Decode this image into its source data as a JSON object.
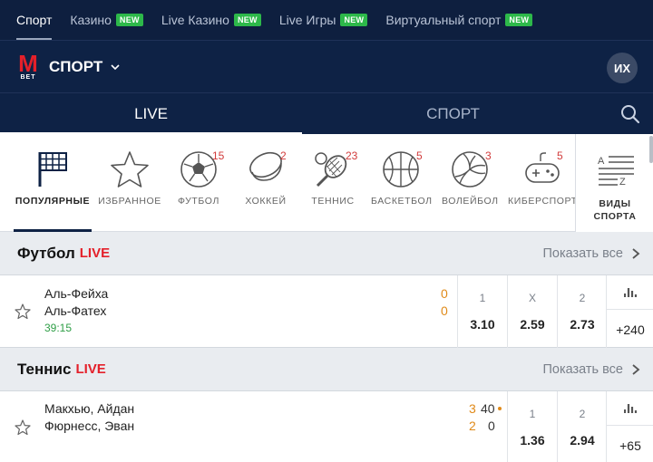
{
  "top_nav": [
    {
      "label": "Спорт",
      "badge": ""
    },
    {
      "label": "Казино",
      "badge": "NEW"
    },
    {
      "label": "Live Казино",
      "badge": "NEW"
    },
    {
      "label": "Live Игры",
      "badge": "NEW"
    },
    {
      "label": "Виртуальный спорт",
      "badge": "NEW"
    }
  ],
  "brand": {
    "logo_letter": "M",
    "logo_sub": "BET",
    "title": "СПОРТ",
    "avatar": "ИХ"
  },
  "tabs": [
    {
      "label": "LIVE"
    },
    {
      "label": "СПОРТ"
    }
  ],
  "sports": [
    {
      "label": "ПОПУЛЯРНЫЕ",
      "count": "",
      "icon": "flag-icon"
    },
    {
      "label": "ИЗБРАННОЕ",
      "count": "",
      "icon": "star-icon"
    },
    {
      "label": "ФУТБОЛ",
      "count": "15",
      "icon": "football-icon"
    },
    {
      "label": "ХОККЕЙ",
      "count": "2",
      "icon": "hockey-puck-icon"
    },
    {
      "label": "ТЕННИС",
      "count": "23",
      "icon": "tennis-icon"
    },
    {
      "label": "БАСКЕТБОЛ",
      "count": "5",
      "icon": "basketball-icon"
    },
    {
      "label": "ВОЛЕЙБОЛ",
      "count": "3",
      "icon": "volleyball-icon"
    },
    {
      "label": "КИБЕРСПОРТ",
      "count": "5",
      "icon": "gamepad-icon"
    }
  ],
  "all_sports": {
    "label_line1": "ВИДЫ",
    "label_line2": "СПОРТА",
    "icon_letters": [
      "A",
      "Z"
    ]
  },
  "sections": [
    {
      "title": "Футбол",
      "live": "LIVE",
      "show_all": "Показать все",
      "event": {
        "team1": "Аль-Фейха",
        "team2": "Аль-Фатех",
        "time": "39:15",
        "score1": "0",
        "score2": "0",
        "odds": [
          {
            "k": "1",
            "v": "3.10"
          },
          {
            "k": "X",
            "v": "2.59"
          },
          {
            "k": "2",
            "v": "2.73"
          }
        ],
        "more": "+240"
      }
    },
    {
      "title": "Теннис",
      "live": "LIVE",
      "show_all": "Показать все",
      "event": {
        "team1": "Макхью, Айдан",
        "team2": "Фюрнесс, Эван",
        "sets1": "3",
        "sets2": "2",
        "points1": "40",
        "points2": "0",
        "odds": [
          {
            "k": "1",
            "v": "1.36"
          },
          {
            "k": "2",
            "v": "2.94"
          }
        ],
        "more": "+65"
      }
    }
  ],
  "colors": {
    "navy": "#0e2245",
    "accent_red": "#e4202a",
    "badge_green": "#2db84a",
    "score_orange": "#e08a19",
    "time_green": "#2e9e46"
  }
}
